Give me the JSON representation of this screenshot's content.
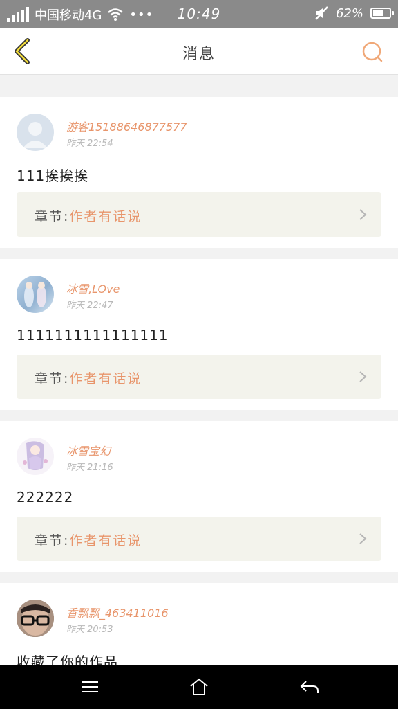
{
  "status_bar": {
    "carrier": "中国移动4G",
    "time": "10:49",
    "battery_text": "62%",
    "battery_level": 0.62
  },
  "header": {
    "title": "消息"
  },
  "messages": [
    {
      "username": "游客15188646877577",
      "time": "昨天 22:54",
      "text": "111挨挨挨",
      "chapter_label": "章节:",
      "chapter_title": "作者有话说"
    },
    {
      "username": "冰雪,LOve",
      "time": "昨天 22:47",
      "text": "1111111111111111",
      "chapter_label": "章节:",
      "chapter_title": "作者有话说"
    },
    {
      "username": "冰雪宝幻",
      "time": "昨天 21:16",
      "text": "222222",
      "chapter_label": "章节:",
      "chapter_title": "作者有话说"
    },
    {
      "username": "香飘飘_463411016",
      "time": "昨天 20:53",
      "text": "收藏了你的作品",
      "chapter_label": "",
      "chapter_title": ""
    }
  ],
  "colors": {
    "accent": "#e8956b",
    "status_bar": "#8a8a8a",
    "chapter_bg": "#f3f3ec"
  },
  "icons": [
    "back-arrow-icon",
    "search-icon",
    "chevron-right-icon",
    "menu-icon",
    "home-icon",
    "back-icon"
  ]
}
